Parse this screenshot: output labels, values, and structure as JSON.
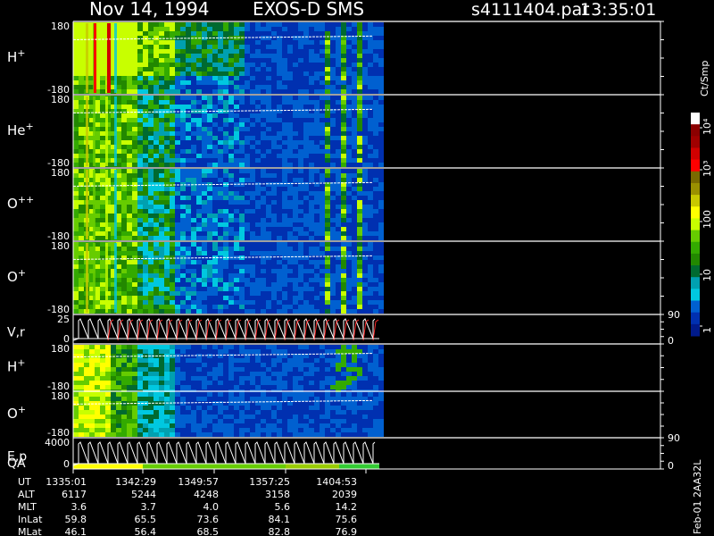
{
  "header": {
    "date": "Nov 14, 1994",
    "instrument": "EXOS-D SMS",
    "file": "s4111404.par",
    "time": "13:35:01"
  },
  "colorbar": {
    "unit": "Ct/Smp",
    "tick_labels": [
      "10⁴",
      "10³",
      "100",
      "10",
      "1"
    ],
    "colors": [
      "#ffffff",
      "#8b0000",
      "#a00000",
      "#d00000",
      "#ff0000",
      "#7a6a00",
      "#9a9000",
      "#c8c800",
      "#ffff00",
      "#c8ff00",
      "#66cc00",
      "#33aa00",
      "#228800",
      "#006a30",
      "#00a0b0",
      "#00c8e0",
      "#0060d0",
      "#0030b0",
      "#001a8a"
    ]
  },
  "chart_data": [
    {
      "type": "heatmap",
      "panel": "H+",
      "label_base": "H",
      "label_sup": "+",
      "yticks": [
        "180",
        "-180"
      ],
      "ylim": [
        -180,
        180
      ],
      "xlim": [
        "1335:01",
        "1404:53"
      ]
    },
    {
      "type": "heatmap",
      "panel": "He+",
      "label_base": "He",
      "label_sup": "+",
      "yticks": [
        "180",
        "-180"
      ],
      "ylim": [
        -180,
        180
      ],
      "xlim": [
        "1335:01",
        "1404:53"
      ]
    },
    {
      "type": "heatmap",
      "panel": "O++",
      "label_base": "O",
      "label_sup": "++",
      "yticks": [
        "180",
        "-180"
      ],
      "ylim": [
        -180,
        180
      ],
      "xlim": [
        "1335:01",
        "1404:53"
      ]
    },
    {
      "type": "heatmap",
      "panel": "O+",
      "label_base": "O",
      "label_sup": "+",
      "yticks": [
        "180",
        "-180"
      ],
      "ylim": [
        -180,
        180
      ],
      "xlim": [
        "1335:01",
        "1404:53"
      ]
    },
    {
      "type": "line",
      "panel": "V,r",
      "label": "V,r",
      "yticks": [
        "25",
        "0"
      ],
      "right_ticks": [
        "90",
        "0"
      ],
      "ylim": [
        0,
        25
      ]
    },
    {
      "type": "heatmap",
      "panel": "H+ (low energy)",
      "label_base": "H",
      "label_sup": "+",
      "yticks": [
        "180",
        "-180"
      ],
      "ylim": [
        -180,
        180
      ]
    },
    {
      "type": "heatmap",
      "panel": "O+ (low energy)",
      "label_base": "O",
      "label_sup": "+",
      "yticks": [
        "180",
        "-180"
      ],
      "ylim": [
        -180,
        180
      ]
    },
    {
      "type": "line",
      "panel": "E,p QA",
      "label": "E,p",
      "label2": "QA",
      "yticks": [
        "4000",
        "0"
      ],
      "right_ticks": [
        "90",
        "0"
      ],
      "ylim": [
        0,
        4000
      ]
    }
  ],
  "orbit_table": {
    "rows": [
      {
        "label": "UT",
        "values": [
          "1335:01",
          "1342:29",
          "1349:57",
          "1357:25",
          "1404:53"
        ]
      },
      {
        "label": "ALT",
        "values": [
          "6117",
          "5244",
          "4248",
          "3158",
          "2039"
        ]
      },
      {
        "label": "MLT",
        "values": [
          "3.6",
          "3.7",
          "4.0",
          "5.6",
          "14.2"
        ]
      },
      {
        "label": "InLat",
        "values": [
          "59.8",
          "65.5",
          "73.6",
          "84.1",
          "75.6"
        ]
      },
      {
        "label": "MLat",
        "values": [
          "46.1",
          "56.4",
          "68.5",
          "82.8",
          "76.9"
        ]
      }
    ]
  },
  "footer_vertical": "Feb-01 2AA32L"
}
